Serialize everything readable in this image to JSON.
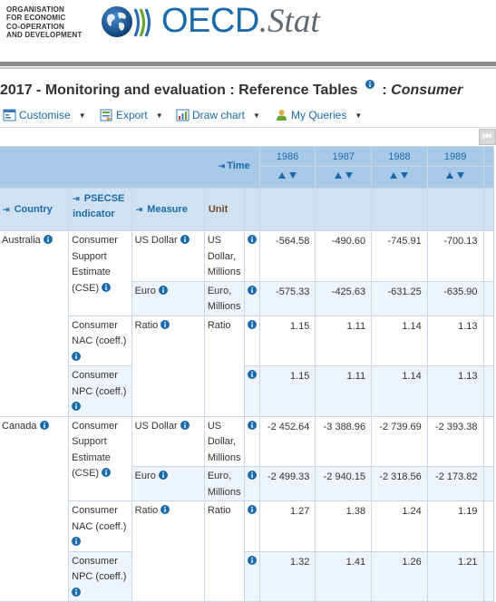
{
  "header": {
    "org_lines": [
      "ORGANISATION",
      "FOR ECONOMIC",
      "CO-OPERATION",
      "AND DEVELOPMENT"
    ],
    "brand_main": "OECD",
    "brand_suffix": ".Stat"
  },
  "title": {
    "main": "2017 - Monitoring and evaluation : Reference Tables",
    "separator": ":",
    "italic": "Consumer"
  },
  "toolbar": {
    "customise": "Customise",
    "export": "Export",
    "draw_chart": "Draw chart",
    "my_queries": "My Queries"
  },
  "table": {
    "time_label": "Time",
    "years": [
      "1986",
      "1987",
      "1988",
      "1989"
    ],
    "col_country": "Country",
    "col_indicator": "PSECSE indicator",
    "col_measure": "Measure",
    "col_unit": "Unit",
    "countries": [
      {
        "name": "Australia",
        "rows": [
          {
            "indicator": "Consumer Support Estimate (CSE)",
            "measure": "US Dollar",
            "unit": "US Dollar, Millions",
            "values": [
              "-564.58",
              "-490.60",
              "-745.91",
              "-700.13"
            ]
          },
          {
            "indicator": "",
            "measure": "Euro",
            "unit": "Euro, Millions",
            "values": [
              "-575.33",
              "-425.63",
              "-631.25",
              "-635.90"
            ]
          },
          {
            "indicator": "Consumer NAC (coeff.)",
            "measure": "Ratio",
            "unit": "Ratio",
            "values": [
              "1.15",
              "1.11",
              "1.14",
              "1.13"
            ]
          },
          {
            "indicator": "Consumer NPC (coeff.)",
            "measure": "",
            "unit": "",
            "values": [
              "1.15",
              "1.11",
              "1.14",
              "1.13"
            ]
          }
        ]
      },
      {
        "name": "Canada",
        "rows": [
          {
            "indicator": "Consumer Support Estimate (CSE)",
            "measure": "US Dollar",
            "unit": "US Dollar, Millions",
            "values": [
              "-2 452.64",
              "-3 388.96",
              "-2 739.69",
              "-2 393.38"
            ]
          },
          {
            "indicator": "",
            "measure": "Euro",
            "unit": "Euro, Millions",
            "values": [
              "-2 499.33",
              "-2 940.15",
              "-2 318.56",
              "-2 173.82"
            ]
          },
          {
            "indicator": "Consumer NAC (coeff.)",
            "measure": "Ratio",
            "unit": "Ratio",
            "values": [
              "1.27",
              "1.38",
              "1.24",
              "1.19"
            ]
          },
          {
            "indicator": "Consumer NPC (coeff.)",
            "measure": "",
            "unit": "",
            "values": [
              "1.32",
              "1.41",
              "1.26",
              "1.21"
            ]
          }
        ]
      }
    ]
  },
  "colors": {
    "oecd_blue": "#1b6bab",
    "header_blue": "#a8c9e8",
    "header_light": "#d0e1f2",
    "row_alt": "#edf4fb",
    "info_icon": "#1b6bab"
  },
  "icons": {
    "customise": "customise-icon",
    "export": "export-icon",
    "draw_chart": "chart-icon",
    "my_queries": "user-icon",
    "info": "info-icon",
    "sort_asc": "sort-ascending-icon",
    "sort_desc": "sort-descending-icon",
    "pin": "pin-icon",
    "collapse": "collapse-panel-icon"
  }
}
